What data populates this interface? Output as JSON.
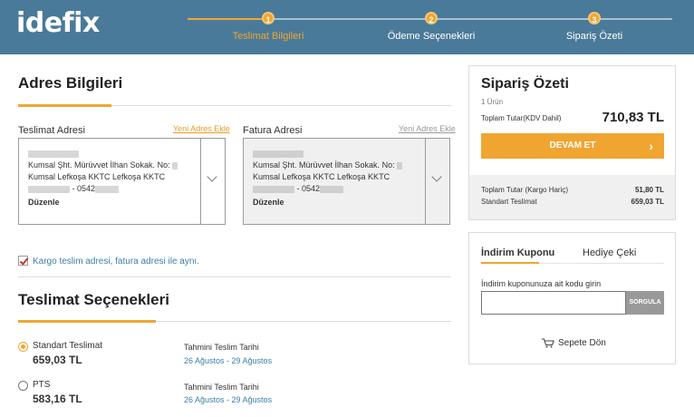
{
  "header": {
    "logo": "idefix",
    "steps": [
      {
        "num": "1",
        "label": "Teslimat Bilgileri"
      },
      {
        "num": "2",
        "label": "Ödeme Seçenekleri"
      },
      {
        "num": "3",
        "label": "Sipariş Özeti"
      }
    ],
    "colors": {
      "bg": "#4a7a99",
      "accent": "#f0a531"
    }
  },
  "address": {
    "title": "Adres Bilgileri",
    "delivery": {
      "label": "Teslimat Adresi",
      "link": "Yeni Adres Ekle",
      "line1": "Kumsal Şht. Mürüvvet İlhan Sokak. No:",
      "line2": "Kumsal Lefkoşa KKTC Lefkoşa KKTC",
      "phone": "- 0542",
      "edit": "Düzenle"
    },
    "billing": {
      "label": "Fatura Adresi",
      "link": "Yeni Adres Ekle",
      "line1": "Kumsal Şht. Mürüvvet İlhan Sokak. No:",
      "line2": "Kumsal Lefkoşa KKTC Lefkoşa KKTC",
      "phone": "- 0542",
      "edit": "Düzenle"
    },
    "same_checkbox_label": "Kargo teslim adresi, fatura adresi ile aynı."
  },
  "shipping": {
    "title": "Teslimat Seçenekleri",
    "options": [
      {
        "name": "Standart Teslimat",
        "price": "659,03 TL",
        "est_label": "Tahmini Teslim Tarihi",
        "dates": "26 Ağustos - 29 Ağustos"
      },
      {
        "name": "PTS",
        "price": "583,16 TL",
        "est_label": "Tahmini Teslim Tarihi",
        "dates": "26 Ağustos - 29 Ağustos"
      }
    ]
  },
  "summary": {
    "title": "Sipariş Özeti",
    "count": "1 Ürün",
    "total_label": "Toplam Tutar(KDV Dahil)",
    "total_value": "710,83 TL",
    "continue_label": "DEVAM ET",
    "continue_arrow": "›",
    "rows": [
      {
        "label": "Toplam Tutar (Kargo Hariç)",
        "value": "51,80 TL"
      },
      {
        "label": "Standart Teslimat",
        "value": "659,03 TL"
      }
    ]
  },
  "coupon": {
    "tabs": [
      "İndirim Kuponu",
      "Hediye Çeki"
    ],
    "desc": "İndirim kuponunuza ait kodu girin",
    "input_value": "",
    "button": "SORGULA",
    "back_to_cart": "Sepete Dön"
  }
}
